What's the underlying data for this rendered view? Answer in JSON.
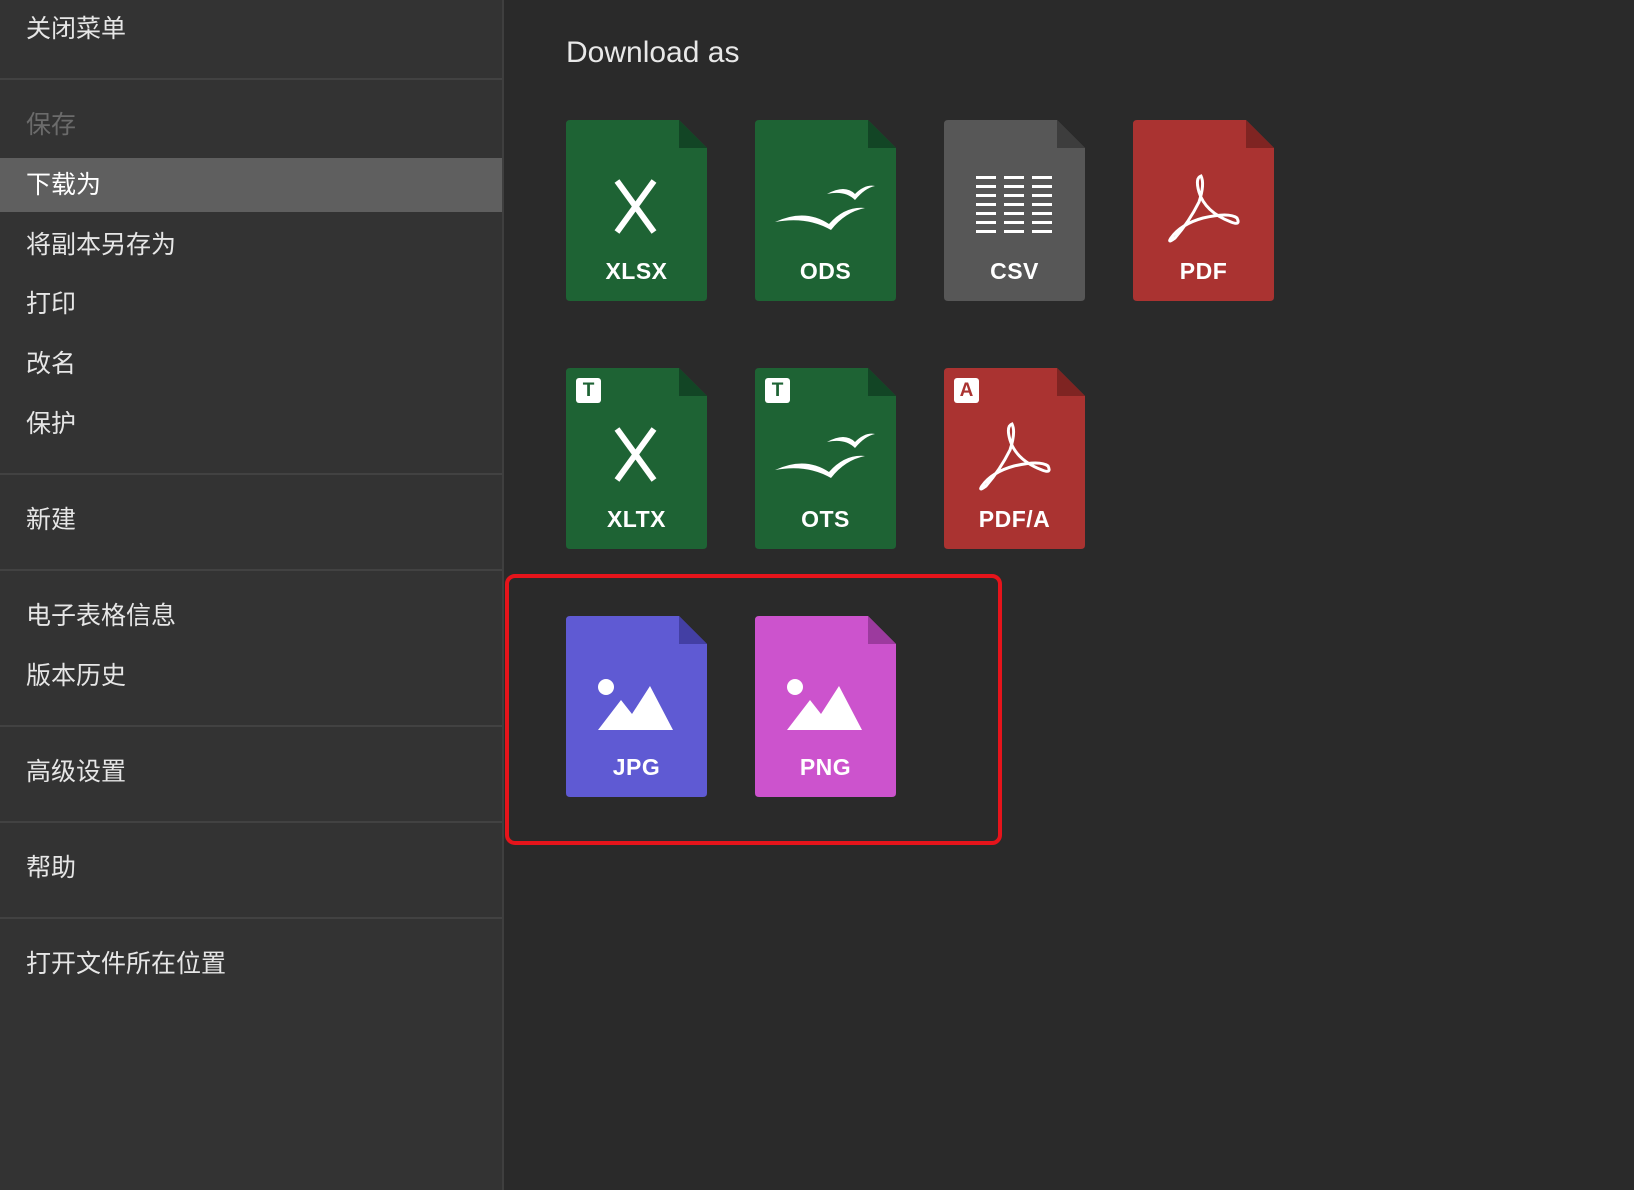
{
  "sidebar": {
    "items": [
      {
        "label": "关闭菜单"
      },
      {
        "label": "保存"
      },
      {
        "label": "下载为"
      },
      {
        "label": "将副本另存为"
      },
      {
        "label": "打印"
      },
      {
        "label": "改名"
      },
      {
        "label": "保护"
      },
      {
        "label": "新建"
      },
      {
        "label": "电子表格信息"
      },
      {
        "label": "版本历史"
      },
      {
        "label": "高级设置"
      },
      {
        "label": "帮助"
      },
      {
        "label": "打开文件所在位置"
      }
    ],
    "selected": "下载为",
    "disabled": [
      "保存"
    ]
  },
  "main": {
    "title": "Download as",
    "formats": [
      {
        "label": "XLSX",
        "icon": "excel-x-icon",
        "color": "#1e6334"
      },
      {
        "label": "ODS",
        "icon": "seagull-icon",
        "color": "#1e6334"
      },
      {
        "label": "CSV",
        "icon": "csv-lines-icon",
        "color": "#575757"
      },
      {
        "label": "PDF",
        "icon": "acrobat-icon",
        "color": "#aa3331"
      },
      {
        "label": "XLTX",
        "icon": "excel-x-icon",
        "badge": "T",
        "color": "#1e6334"
      },
      {
        "label": "OTS",
        "icon": "seagull-icon",
        "badge": "T",
        "color": "#1e6334"
      },
      {
        "label": "PDF/A",
        "icon": "acrobat-icon",
        "badge": "A",
        "color": "#aa3331"
      },
      {
        "label": "JPG",
        "icon": "image-icon",
        "color": "#5f5ad3"
      },
      {
        "label": "PNG",
        "icon": "image-icon",
        "color": "#cc53cd"
      }
    ]
  },
  "highlight_color": "#e5141b"
}
